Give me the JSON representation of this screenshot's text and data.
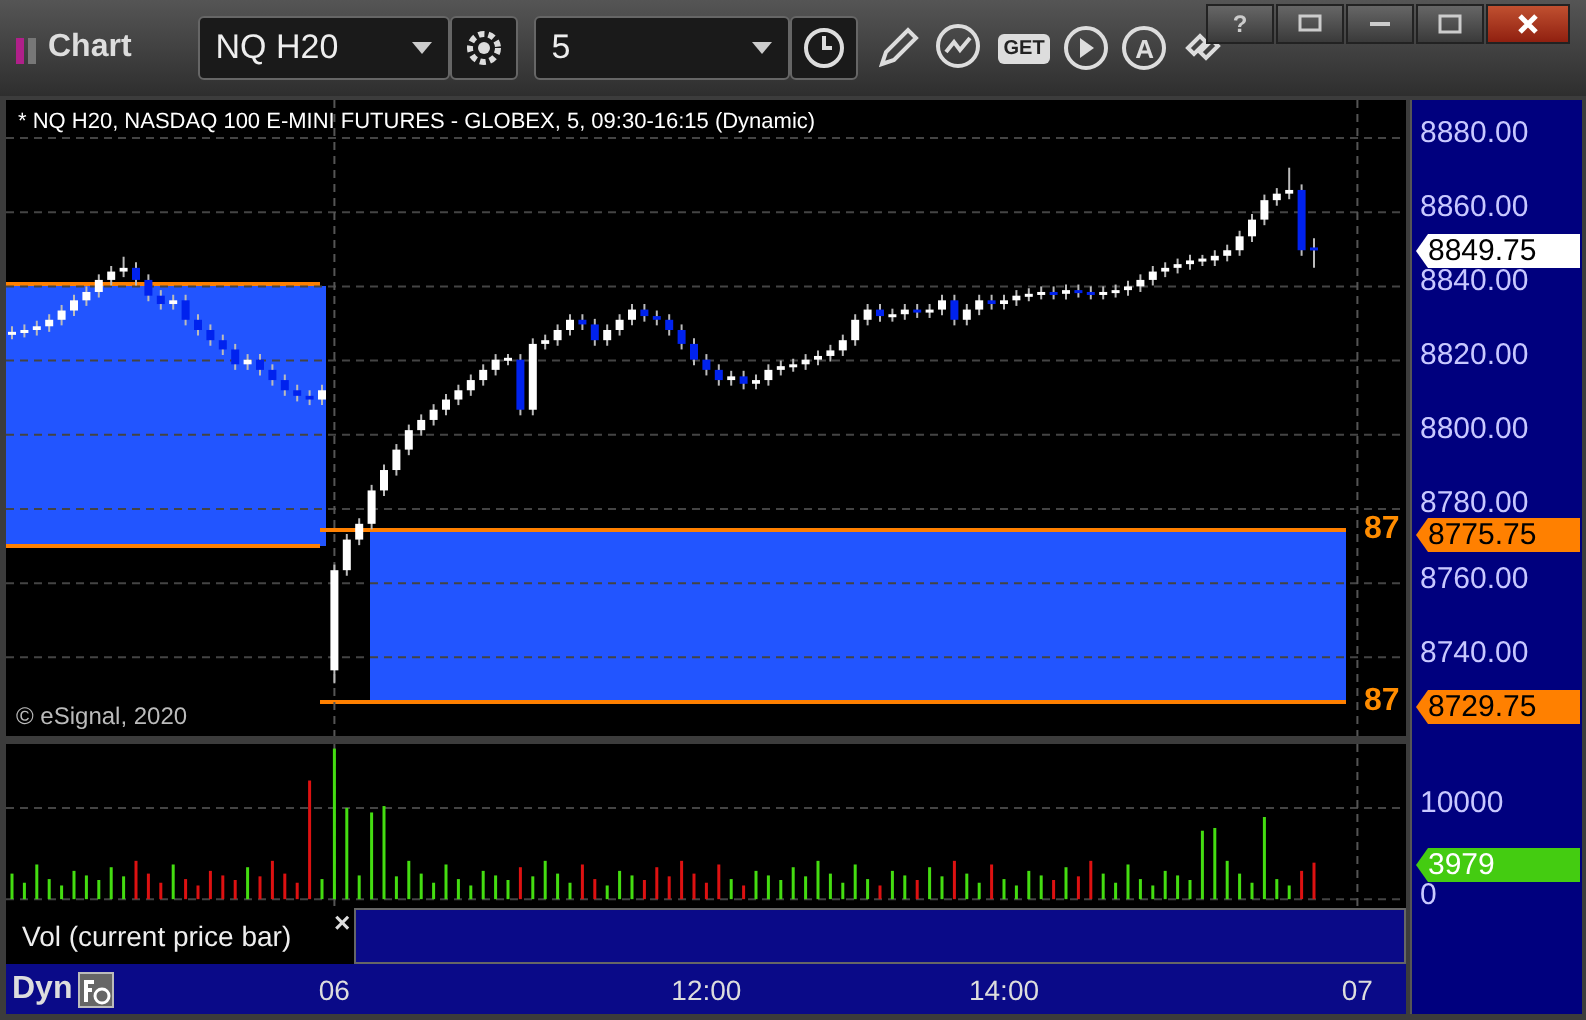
{
  "window": {
    "title": "Chart",
    "help": "?"
  },
  "toolbar": {
    "symbol": "NQ H20",
    "interval": "5",
    "get_label": "GET",
    "auto_label": "A"
  },
  "price_pane": {
    "header": "* NQ H20, NASDAQ 100 E-MINI FUTURES - GLOBEX, 5, 09:30-16:15 (Dynamic)",
    "copyright": "© eSignal, 2020",
    "last_price": "8849.75",
    "zones": [
      {
        "label": "87",
        "price": "8775.75"
      },
      {
        "label": "87",
        "price": "8729.75"
      }
    ],
    "chart_data": {
      "type": "candlestick",
      "grid": true,
      "ylim": [
        8718.8,
        8890.25
      ],
      "categories": [
        null,
        null,
        null,
        null,
        null,
        null,
        null,
        null,
        null,
        null,
        null,
        null,
        null,
        null,
        null,
        null,
        null,
        null,
        null,
        null,
        null,
        null,
        null,
        null,
        null,
        null,
        null,
        null,
        null,
        null,
        null,
        null,
        null,
        null,
        null,
        null,
        null,
        null,
        null,
        null,
        null,
        null,
        null,
        null,
        null,
        null,
        null,
        null,
        null,
        null,
        null,
        null,
        null,
        null,
        null,
        null,
        null,
        null,
        null,
        null,
        null,
        null,
        null,
        null,
        null,
        null,
        null,
        null,
        null,
        null,
        null,
        null,
        null,
        null,
        null,
        null,
        null,
        null,
        null,
        null,
        null,
        null,
        null,
        null,
        null,
        null,
        null,
        null,
        null,
        null,
        null,
        null,
        null,
        null,
        null,
        null,
        null,
        null,
        null,
        null,
        null,
        null,
        null,
        null,
        null,
        null
      ],
      "ohlc": [
        [
          8827.25,
          8829.25,
          8825.75,
          8827.75
        ],
        [
          8827.75,
          8829.75,
          8826.25,
          8828.25
        ],
        [
          8828.25,
          8830.75,
          8826.75,
          8829.25
        ],
        [
          8829.25,
          8832.5,
          8827.75,
          8831
        ],
        [
          8831,
          8835,
          8829.5,
          8833.5
        ],
        [
          8833.5,
          8837.75,
          8832,
          8836.25
        ],
        [
          8836.25,
          8840,
          8834.75,
          8838.5
        ],
        [
          8838.5,
          8843.25,
          8837,
          8841.75
        ],
        [
          8841.75,
          8845.5,
          8840.25,
          8844
        ],
        [
          8844,
          8848,
          8842.5,
          8845
        ],
        [
          8845,
          8846.5,
          8840.25,
          8841.75
        ],
        [
          8841.75,
          8843.25,
          8836,
          8837.5
        ],
        [
          8837.5,
          8839,
          8833.75,
          8835.25
        ],
        [
          8835.25,
          8837.75,
          8833.75,
          8836.25
        ],
        [
          8836.25,
          8837.75,
          8829.5,
          8831
        ],
        [
          8831,
          8832.5,
          8826.75,
          8828.25
        ],
        [
          8828.25,
          8829.75,
          8824,
          8825.5
        ],
        [
          8825.5,
          8827,
          8821.5,
          8823
        ],
        [
          8823,
          8824.5,
          8817.5,
          8819
        ],
        [
          8819,
          8821.75,
          8817.5,
          8820.25
        ],
        [
          8820.25,
          8821.75,
          8816,
          8817.5
        ],
        [
          8817.5,
          8819,
          8813.25,
          8814.75
        ],
        [
          8814.75,
          8816.25,
          8810.5,
          8812
        ],
        [
          8812,
          8813.5,
          8809,
          8810.5
        ],
        [
          8810.5,
          8812,
          8808,
          8809.5
        ],
        [
          8809.5,
          8813.5,
          8808,
          8812
        ],
        [
          8736.5,
          8765,
          8733,
          8763.5
        ],
        [
          8763.5,
          8773.25,
          8762,
          8771.75
        ],
        [
          8771.75,
          8777.5,
          8770.25,
          8776
        ],
        [
          8776,
          8786.5,
          8774.5,
          8785
        ],
        [
          8785,
          8792,
          8783.5,
          8790.5
        ],
        [
          8790.5,
          8797.5,
          8789,
          8796
        ],
        [
          8796,
          8802.75,
          8794.5,
          8801.25
        ],
        [
          8801.25,
          8805.5,
          8799.75,
          8804
        ],
        [
          8804,
          8808.25,
          8802.5,
          8806.75
        ],
        [
          8806.75,
          8811,
          8805.25,
          8809.5
        ],
        [
          8809.5,
          8813.5,
          8808,
          8812
        ],
        [
          8812,
          8816.25,
          8810.5,
          8814.75
        ],
        [
          8814.75,
          8819,
          8813.25,
          8817.5
        ],
        [
          8817.5,
          8821.75,
          8816,
          8820.25
        ],
        [
          8820.25,
          8821.75,
          8818.75,
          8820.75
        ],
        [
          8820.25,
          8821.75,
          8805.25,
          8806.75
        ],
        [
          8806.75,
          8826,
          8805.25,
          8824.5
        ],
        [
          8824.5,
          8827,
          8823,
          8825.5
        ],
        [
          8825.5,
          8829.75,
          8824,
          8828.25
        ],
        [
          8828.25,
          8832.5,
          8826.75,
          8831
        ],
        [
          8831,
          8832.5,
          8828.25,
          8829.75
        ],
        [
          8829.75,
          8831.25,
          8824,
          8825.5
        ],
        [
          8825.5,
          8829.75,
          8824,
          8828.25
        ],
        [
          8828.25,
          8832.5,
          8826.75,
          8831
        ],
        [
          8831,
          8835.25,
          8829.5,
          8833.75
        ],
        [
          8833.75,
          8835.25,
          8830.5,
          8832
        ],
        [
          8832,
          8833.5,
          8829.5,
          8831
        ],
        [
          8831,
          8832.5,
          8826.75,
          8828.25
        ],
        [
          8828.25,
          8829.75,
          8823,
          8824.5
        ],
        [
          8824.5,
          8826,
          8818.75,
          8820.25
        ],
        [
          8820.25,
          8821.75,
          8816,
          8817.5
        ],
        [
          8817.5,
          8819,
          8813.25,
          8814.75
        ],
        [
          8814.75,
          8817.25,
          8813.25,
          8815.75
        ],
        [
          8815.75,
          8817.25,
          8812.25,
          8813.75
        ],
        [
          8813.75,
          8816.25,
          8812.25,
          8814.75
        ],
        [
          8814.75,
          8819,
          8813.25,
          8817.5
        ],
        [
          8817.5,
          8820,
          8816,
          8818.5
        ],
        [
          8818.5,
          8820.5,
          8817,
          8819
        ],
        [
          8819,
          8821.75,
          8817.5,
          8820.25
        ],
        [
          8820.25,
          8822.75,
          8818.75,
          8821.25
        ],
        [
          8821.25,
          8824.25,
          8819.75,
          8822.75
        ],
        [
          8822.75,
          8827,
          8821.25,
          8825.5
        ],
        [
          8825.5,
          8832.5,
          8824,
          8831
        ],
        [
          8831,
          8835.25,
          8829.5,
          8833.75
        ],
        [
          8833.75,
          8835.25,
          8830.5,
          8832
        ],
        [
          8832,
          8834,
          8830.5,
          8832.5
        ],
        [
          8832.5,
          8835.25,
          8831,
          8833.75
        ],
        [
          8833.75,
          8835.25,
          8831.5,
          8833
        ],
        [
          8833,
          8835.25,
          8831.5,
          8833.75
        ],
        [
          8833.75,
          8837.75,
          8832.25,
          8836.25
        ],
        [
          8836.25,
          8837.75,
          8829.5,
          8831
        ],
        [
          8831,
          8835.25,
          8829.5,
          8833.75
        ],
        [
          8833.75,
          8837.75,
          8832.25,
          8836.25
        ],
        [
          8836.25,
          8837.75,
          8833.75,
          8835.25
        ],
        [
          8835.25,
          8837.75,
          8833.75,
          8836.25
        ],
        [
          8836.25,
          8839,
          8834.75,
          8837.5
        ],
        [
          8837.5,
          8839.5,
          8836,
          8838
        ],
        [
          8838,
          8840,
          8836.5,
          8838.5
        ],
        [
          8838.5,
          8840,
          8836.5,
          8838
        ],
        [
          8838,
          8840.5,
          8836.5,
          8839
        ],
        [
          8839,
          8840.5,
          8837,
          8838.5
        ],
        [
          8838.5,
          8840,
          8836.5,
          8838
        ],
        [
          8838,
          8840,
          8836.5,
          8838.5
        ],
        [
          8838.5,
          8840.5,
          8837,
          8839
        ],
        [
          8839,
          8841.5,
          8837.5,
          8840
        ],
        [
          8840,
          8843.25,
          8838.5,
          8841.75
        ],
        [
          8841.75,
          8845.5,
          8840.25,
          8844
        ],
        [
          8844,
          8846.5,
          8842.5,
          8845
        ],
        [
          8845,
          8847.5,
          8843.5,
          8846
        ],
        [
          8846,
          8848.5,
          8844.5,
          8847
        ],
        [
          8847,
          8848.5,
          8845.5,
          8847.5
        ],
        [
          8847,
          8849.75,
          8845.5,
          8848.25
        ],
        [
          8848.25,
          8851.25,
          8846.75,
          8849.75
        ],
        [
          8849.75,
          8855,
          8848.25,
          8853.5
        ],
        [
          8853.5,
          8859.5,
          8852,
          8858
        ],
        [
          8858,
          8864.75,
          8856.5,
          8863.25
        ],
        [
          8863.25,
          8866.5,
          8861.75,
          8865
        ],
        [
          8865,
          8872,
          8863.5,
          8866
        ],
        [
          8866,
          8867.5,
          8848.25,
          8849.75
        ],
        [
          8850.5,
          8853,
          8845,
          8849.75
        ]
      ],
      "yticks": [
        {
          "value": 8880,
          "label": "8880.00"
        },
        {
          "value": 8860,
          "label": "8860.00"
        },
        {
          "value": 8840,
          "label": "8840.00"
        },
        {
          "value": 8820,
          "label": "8820.00"
        },
        {
          "value": 8800,
          "label": "8800.00"
        },
        {
          "value": 8780,
          "label": "8780.00"
        },
        {
          "value": 8760,
          "label": "8760.00"
        },
        {
          "value": 8740,
          "label": "8740.00"
        }
      ]
    }
  },
  "volume_pane": {
    "last": "3979",
    "legend": "Vol (current price bar)",
    "close": "×",
    "chart_data": {
      "type": "bar",
      "grid": true,
      "ylim": [
        -12800,
        17000
      ],
      "categories": [
        null,
        null,
        null,
        null,
        null,
        null,
        null,
        null,
        null,
        null,
        null,
        null,
        null,
        null,
        null,
        null,
        null,
        null,
        null,
        null,
        null,
        null,
        null,
        null,
        null,
        null,
        "06",
        null,
        null,
        null,
        null,
        null,
        null,
        null,
        null,
        null,
        null,
        null,
        null,
        null,
        null,
        null,
        null,
        null,
        null,
        null,
        null,
        null,
        null,
        null,
        null,
        null,
        null,
        null,
        null,
        null,
        "12:00",
        null,
        null,
        null,
        null,
        null,
        null,
        null,
        null,
        null,
        null,
        null,
        null,
        null,
        null,
        null,
        null,
        null,
        null,
        null,
        null,
        null,
        null,
        null,
        "14:00",
        null,
        null,
        null,
        null,
        null,
        null,
        null,
        null,
        null,
        null,
        null,
        null,
        null,
        null,
        null,
        null,
        null,
        null,
        null,
        null,
        null,
        null,
        null,
        null,
        null
      ],
      "values": [
        2800,
        1800,
        3800,
        2200,
        1500,
        3100,
        2600,
        2100,
        3500,
        2500,
        4200,
        2800,
        1800,
        3800,
        2200,
        1500,
        3100,
        2600,
        2100,
        3500,
        2500,
        4200,
        2800,
        1800,
        13000,
        2200,
        16500,
        10000,
        2600,
        9500,
        10200,
        2500,
        4200,
        2800,
        1800,
        3800,
        2200,
        1500,
        3100,
        2600,
        2100,
        3500,
        2500,
        4200,
        2800,
        1800,
        3800,
        2200,
        1500,
        3100,
        2600,
        2100,
        3500,
        2500,
        4200,
        2800,
        1800,
        3800,
        2200,
        1500,
        3100,
        2600,
        2100,
        3500,
        2500,
        4200,
        2800,
        1800,
        3800,
        2200,
        1500,
        3100,
        2600,
        2100,
        3500,
        2500,
        4200,
        2800,
        1800,
        3800,
        2200,
        1500,
        3100,
        2600,
        2100,
        3500,
        2500,
        4200,
        2800,
        1800,
        3800,
        2200,
        1500,
        3100,
        2600,
        2100,
        7500,
        7800,
        4200,
        2800,
        1800,
        9000,
        2200,
        1500,
        3100,
        4000
      ],
      "yticks": [
        {
          "value": 10000,
          "label": "10000"
        },
        {
          "value": 0,
          "label": "0"
        }
      ]
    }
  },
  "time_axis": {
    "mode": "Dyn",
    "end_label": "07"
  }
}
